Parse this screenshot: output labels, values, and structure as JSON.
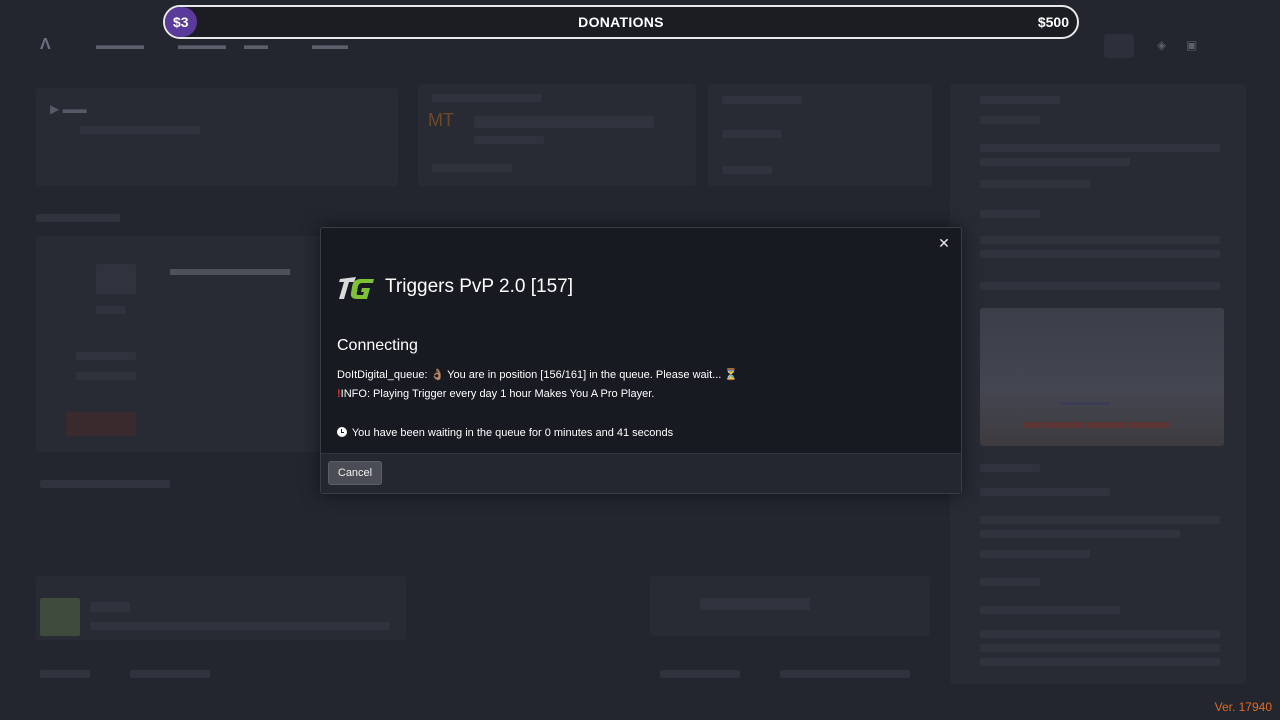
{
  "donations": {
    "label": "DONATIONS",
    "current": "$3",
    "goal": "$500",
    "progress_fraction": 0.006,
    "bar_color": "#5a3a9a"
  },
  "modal": {
    "server_name": "Triggers PvP 2.0 [157]",
    "server_logo_icon": "tg-logo-icon",
    "status_heading": "Connecting",
    "queue_message_prefix": "DoItDigital_queue:",
    "queue_message_emoji": "👌🏽",
    "queue_message_text": "You are in position [156/161] in the queue. Please wait...",
    "queue_message_hourglass": "⏳",
    "info_mark": "!",
    "info_message": "INFO: Playing Trigger every day 1 hour Makes You A Pro Player.",
    "wait_message": "You have been waiting in the queue for 0 minutes and 41 seconds",
    "close_label": "✕",
    "cancel_label": "Cancel"
  },
  "version": "Ver. 17940",
  "colors": {
    "accent_logo_green": "#7fc235",
    "version_orange": "#e06b20",
    "modal_bg": "#181a21"
  }
}
